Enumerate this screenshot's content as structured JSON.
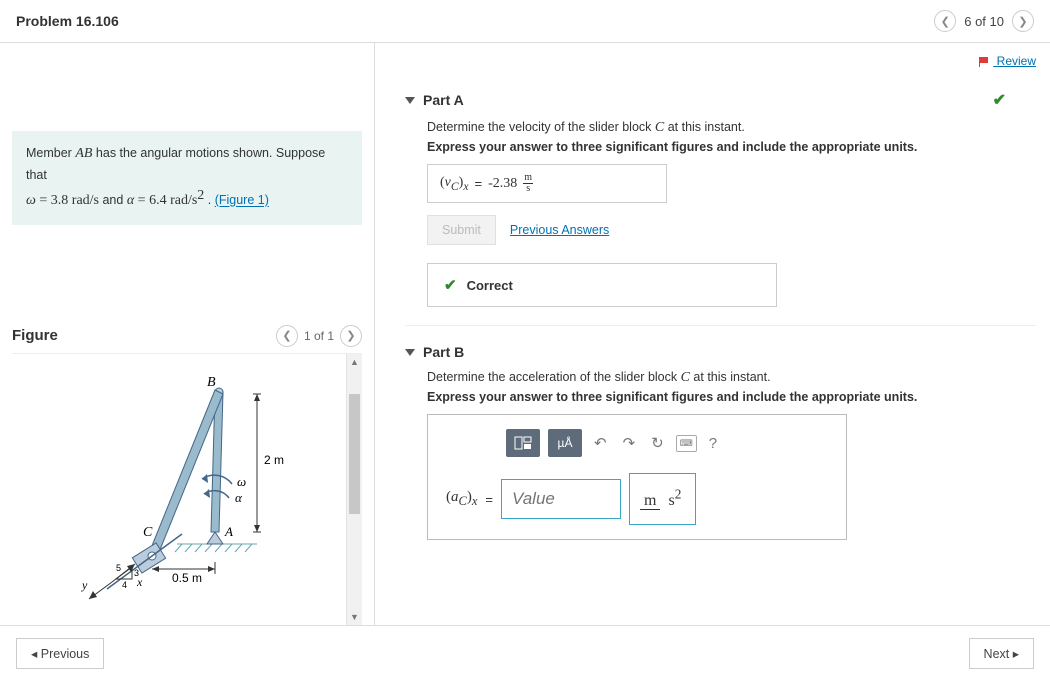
{
  "header": {
    "title": "Problem 16.106",
    "position": "6 of 10"
  },
  "review": {
    "label": " Review"
  },
  "prompt": {
    "text_prefix": "Member ",
    "member": "AB",
    "text_mid": " has the angular motions shown. Suppose that ",
    "omega_sym": "ω",
    "omega_val": " = 3.8  rad/s",
    "and": " and ",
    "alpha_sym": "α",
    "alpha_val": " = 6.4  rad/s",
    "alpha_exp": "2",
    "period": " . ",
    "figure_link": "(Figure 1)"
  },
  "figure": {
    "title": "Figure",
    "nav": "1 of 1",
    "labels": {
      "B": "B",
      "C": "C",
      "A": "A",
      "omega": "ω",
      "alpha": "α",
      "dim2m": "2 m",
      "dim05m": "0.5 m",
      "x": "x",
      "y": "y",
      "r5": "5",
      "r3": "3",
      "r4": "4"
    }
  },
  "partA": {
    "title": "Part A",
    "desc_prefix": "Determine the velocity of the slider block ",
    "desc_var": "C",
    "desc_suffix": " at this instant.",
    "instr": "Express your answer to three significant figures and include the appropriate units.",
    "var": "v",
    "sub1": "C",
    "sub2": "x",
    "eq": " = ",
    "value": "-2.38",
    "unit_top": "m",
    "unit_bot": "s",
    "submit": "Submit",
    "prev_answers": "Previous Answers",
    "correct": "Correct"
  },
  "partB": {
    "title": "Part B",
    "desc_prefix": "Determine the acceleration of the slider block ",
    "desc_var": "C",
    "desc_suffix": " at this instant.",
    "instr": "Express your answer to three significant figures and include the appropriate units.",
    "tools": {
      "units_label": "µÅ",
      "help": "?"
    },
    "var": "a",
    "sub1": "C",
    "sub2": "x",
    "eq": " = ",
    "placeholder": "Value",
    "unit_top": "m",
    "unit_bot_base": "s",
    "unit_bot_exp": "2"
  },
  "footer": {
    "prev": "Previous",
    "next": "Next"
  }
}
